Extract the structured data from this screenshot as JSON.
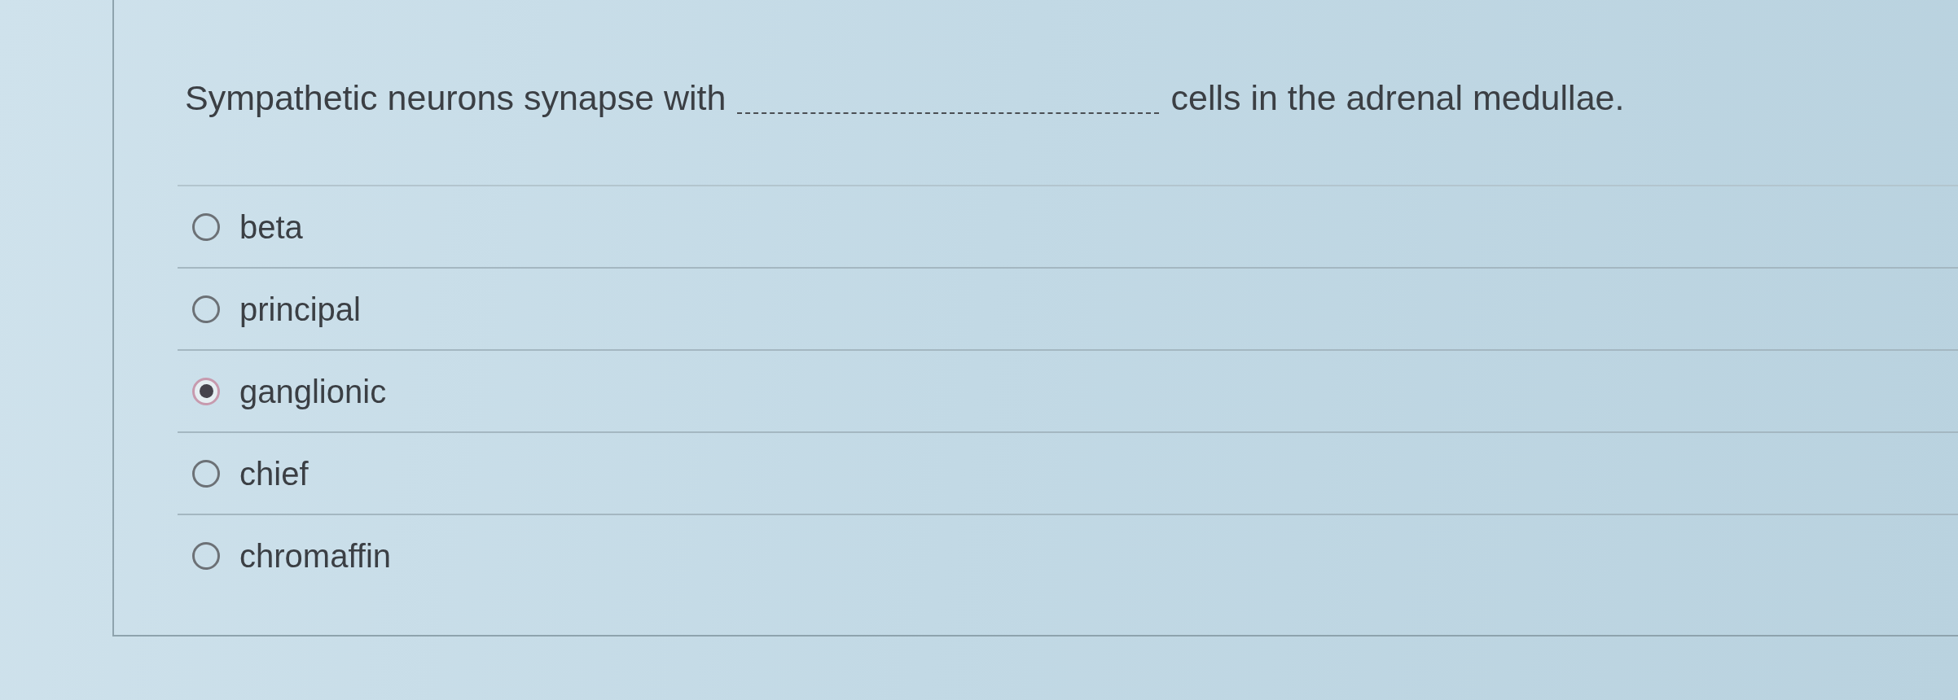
{
  "question": {
    "before": "Sympathetic neurons synapse with",
    "after": "cells in the adrenal medullae."
  },
  "options": [
    {
      "label": "beta",
      "selected": false
    },
    {
      "label": "principal",
      "selected": false
    },
    {
      "label": "ganglionic",
      "selected": true
    },
    {
      "label": "chief",
      "selected": false
    },
    {
      "label": "chromaffin",
      "selected": false
    }
  ]
}
